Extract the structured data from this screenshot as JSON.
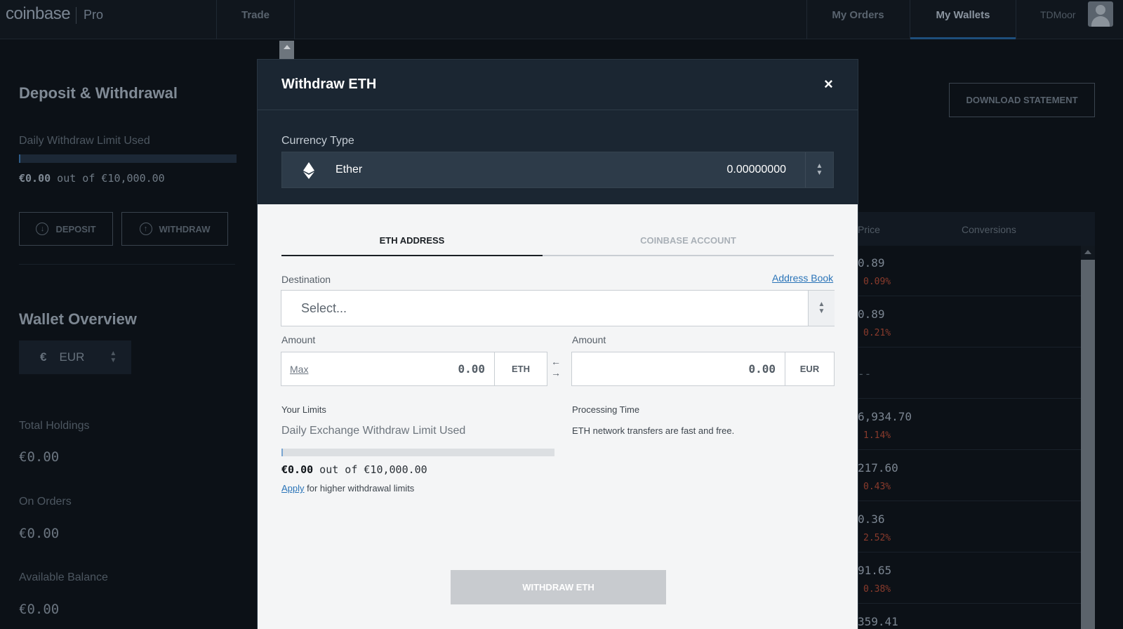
{
  "header": {
    "logo": "coinbase",
    "logo_sub": "Pro",
    "nav": {
      "trade": "Trade",
      "my_orders": "My Orders",
      "my_wallets": "My Wallets"
    },
    "username": "TDMoor"
  },
  "left": {
    "title": "Deposit & Withdrawal",
    "daily_limit_label": "Daily Withdraw Limit Used",
    "daily_limit_used": "€0.00",
    "daily_limit_rest": " out of €10,000.00",
    "deposit_label": "DEPOSIT",
    "withdraw_label": "WITHDRAW",
    "wallet_overview_title": "Wallet Overview",
    "currency_symbol": "€",
    "currency_code": "EUR",
    "total_holdings_label": "Total Holdings",
    "total_holdings": "€0.00",
    "on_orders_label": "On Orders",
    "on_orders": "€0.00",
    "available_label": "Available Balance",
    "available": "€0.00"
  },
  "right": {
    "download_label": "DOWNLOAD STATEMENT",
    "col_price": "Price",
    "col_conversions": "Conversions",
    "rows": [
      {
        "price": "0.89",
        "change": "0.09%"
      },
      {
        "price": "0.89",
        "change": "0.21%"
      },
      {
        "price": "--",
        "change": ""
      },
      {
        "price": "6,934.70",
        "change": "1.14%"
      },
      {
        "price": "217.60",
        "change": "0.43%"
      },
      {
        "price": "0.36",
        "change": "2.52%"
      },
      {
        "price": "91.65",
        "change": "0.38%"
      },
      {
        "price": "359.41",
        "change": ""
      }
    ]
  },
  "modal": {
    "title": "Withdraw ETH",
    "close": "×",
    "currency_type_label": "Currency Type",
    "currency_name": "Ether",
    "currency_balance": "0.00000000",
    "tab_address": "ETH ADDRESS",
    "tab_coinbase": "COINBASE ACCOUNT",
    "destination_label": "Destination",
    "address_book": "Address Book",
    "destination_placeholder": "Select...",
    "amount_label": "Amount",
    "max_label": "Max",
    "amount_eth": "0.00",
    "unit_eth": "ETH",
    "amount_eur": "0.00",
    "unit_eur": "EUR",
    "limits_label": "Your Limits",
    "limits_sub": "Daily Exchange Withdraw Limit Used",
    "limit_fraction_used": 0,
    "limit_used": "€0.00",
    "limit_rest": " out of €10,000.00",
    "apply_link": "Apply",
    "apply_rest": " for higher withdrawal limits",
    "processing_label": "Processing Time",
    "processing_text": "ETH network transfers are fast and free.",
    "submit_label": "WITHDRAW ETH"
  },
  "colors": {
    "accent_link": "#2a74b8",
    "negative_change": "#8a3b2c",
    "modal_header_bg": "#1b2632"
  }
}
